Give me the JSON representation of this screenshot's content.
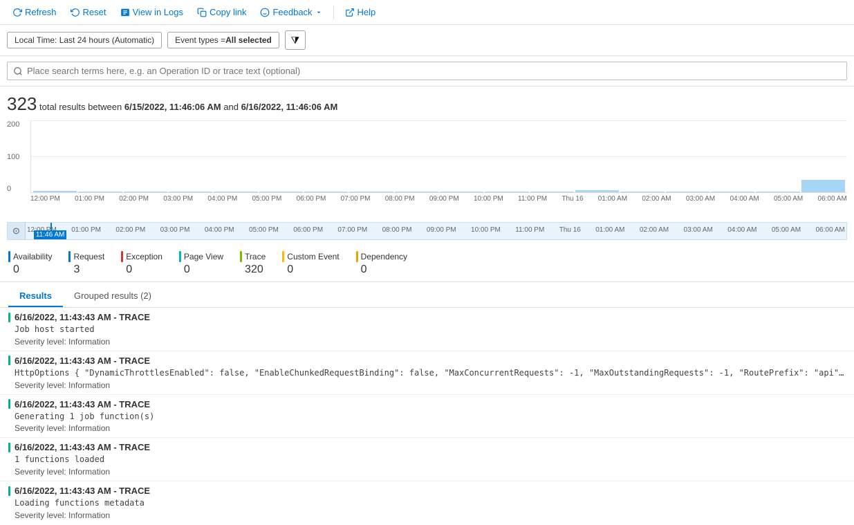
{
  "toolbar": {
    "refresh_label": "Refresh",
    "reset_label": "Reset",
    "view_in_logs_label": "View in Logs",
    "copy_link_label": "Copy link",
    "feedback_label": "Feedback",
    "help_label": "Help"
  },
  "filters": {
    "time_filter": "Local Time: Last 24 hours (Automatic)",
    "event_type_prefix": "Event types = ",
    "event_type_value": "All selected"
  },
  "search": {
    "placeholder": "Place search terms here, e.g. an Operation ID or trace text (optional)"
  },
  "summary": {
    "count": "323",
    "label": "total results between",
    "start_date": "6/15/2022, 11:46:06 AM",
    "and_label": "and",
    "end_date": "6/16/2022, 11:46:06 AM"
  },
  "chart": {
    "y_labels": [
      "200",
      "100",
      "0"
    ],
    "time_labels": [
      "12:00 PM",
      "01:00 PM",
      "02:00 PM",
      "03:00 PM",
      "04:00 PM",
      "05:00 PM",
      "06:00 PM",
      "07:00 PM",
      "08:00 PM",
      "09:00 PM",
      "10:00 PM",
      "11:00 PM",
      "Thu 16",
      "01:00 AM",
      "02:00 AM",
      "03:00 AM",
      "04:00 AM",
      "05:00 AM",
      "06:00 AM"
    ],
    "cursor_label": "11:46 AM"
  },
  "legend": [
    {
      "name": "Availability",
      "count": "0",
      "color": "#0078d4"
    },
    {
      "name": "Request",
      "count": "3",
      "color": "#0078d4"
    },
    {
      "name": "Exception",
      "count": "0",
      "color": "#d13438"
    },
    {
      "name": "Page View",
      "count": "0",
      "color": "#00b7c3"
    },
    {
      "name": "Trace",
      "count": "320",
      "color": "#7fba00"
    },
    {
      "name": "Custom Event",
      "count": "0",
      "color": "#ffb900"
    },
    {
      "name": "Dependency",
      "count": "0",
      "color": "#e3a800"
    }
  ],
  "tabs": [
    {
      "label": "Results",
      "active": true
    },
    {
      "label": "Grouped results (2)",
      "active": false
    }
  ],
  "results": [
    {
      "datetime": "6/16/2022, 11:43:43 AM",
      "type": "TRACE",
      "body": "Job host started",
      "severity": "Severity level: Information"
    },
    {
      "datetime": "6/16/2022, 11:43:43 AM",
      "type": "TRACE",
      "body": "HttpOptions { \"DynamicThrottlesEnabled\": false, \"EnableChunkedRequestBinding\": false, \"MaxConcurrentRequests\": -1, \"MaxOutstandingRequests\": -1, \"RoutePrefix\": \"api\" }",
      "severity": "Severity level: Information"
    },
    {
      "datetime": "6/16/2022, 11:43:43 AM",
      "type": "TRACE",
      "body": "Generating 1 job function(s)",
      "severity": "Severity level: Information"
    },
    {
      "datetime": "6/16/2022, 11:43:43 AM",
      "type": "TRACE",
      "body": "1 functions loaded",
      "severity": "Severity level: Information"
    },
    {
      "datetime": "6/16/2022, 11:43:43 AM",
      "type": "TRACE",
      "body": "Loading functions metadata",
      "severity": "Severity level: Information"
    }
  ]
}
